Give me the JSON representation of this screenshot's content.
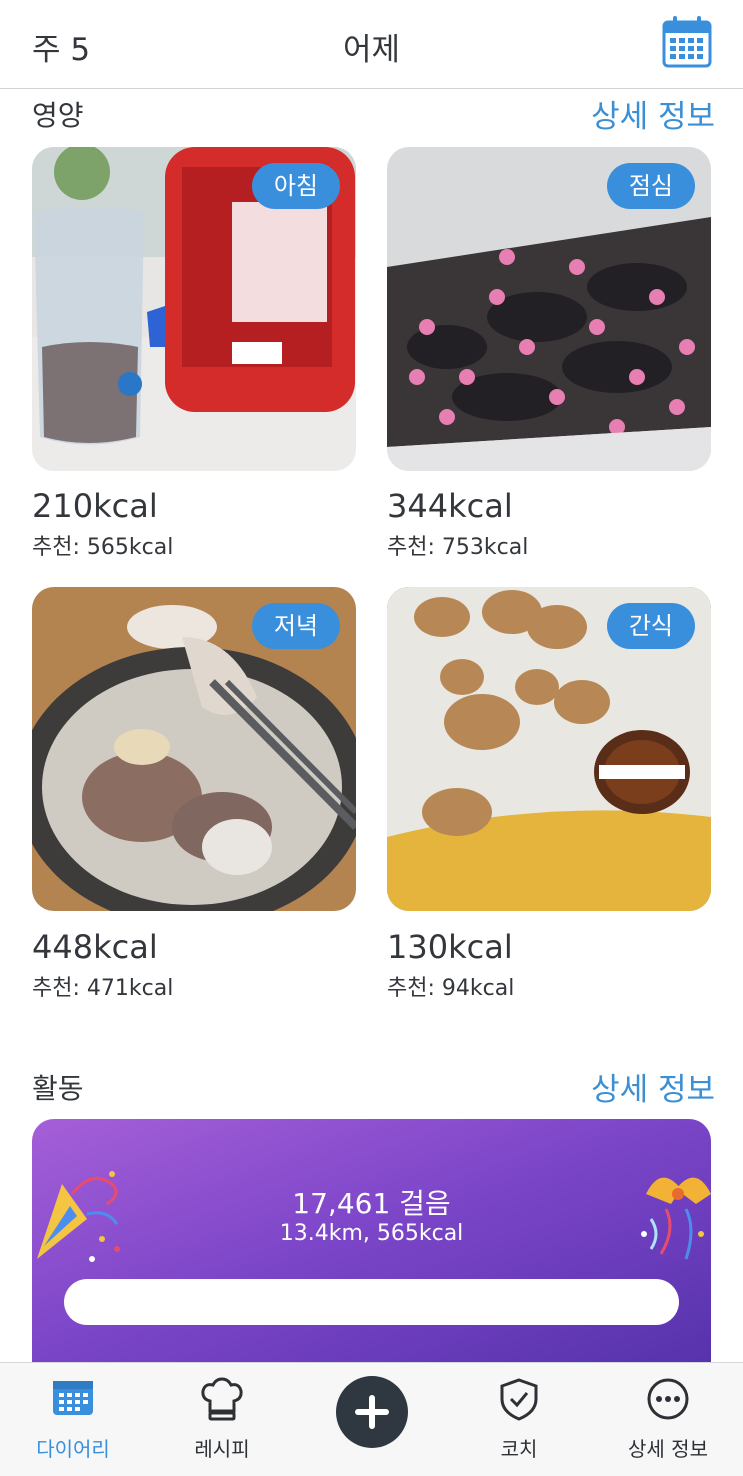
{
  "header": {
    "week": "주 5",
    "title": "어제"
  },
  "nutrition": {
    "title": "영양",
    "detail": "상세 정보",
    "meals": [
      {
        "badge": "아침",
        "kcal": "210kcal",
        "recommended": "추천: 565kcal"
      },
      {
        "badge": "점심",
        "kcal": "344kcal",
        "recommended": "추천: 753kcal"
      },
      {
        "badge": "저녁",
        "kcal": "448kcal",
        "recommended": "추천: 471kcal"
      },
      {
        "badge": "간식",
        "kcal": "130kcal",
        "recommended": "추천: 94kcal"
      }
    ]
  },
  "activity": {
    "title": "활동",
    "detail": "상세 정보",
    "steps": "17,461 걸음",
    "summary": "13.4km, 565kcal"
  },
  "tabs": [
    {
      "label": "다이어리",
      "icon": "calendar-icon",
      "active": true
    },
    {
      "label": "레시피",
      "icon": "chef-hat-icon",
      "active": false
    },
    {
      "label": "",
      "icon": "plus-icon",
      "active": false
    },
    {
      "label": "코치",
      "icon": "shield-check-icon",
      "active": false
    },
    {
      "label": "상세 정보",
      "icon": "more-icon",
      "active": false
    }
  ],
  "colors": {
    "accent": "#3a8fdc",
    "badge": "#3a8fdc",
    "activity_start": "#a55fd8",
    "activity_end": "#5130a8"
  }
}
